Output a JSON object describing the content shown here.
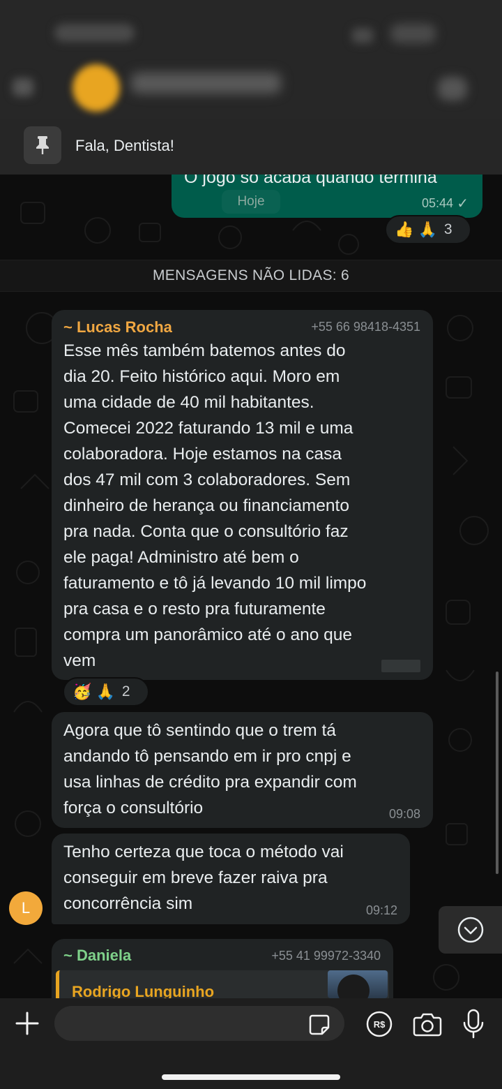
{
  "pinned": {
    "text": "Fala, Dentista!"
  },
  "outgoing": {
    "text": "O jogo só acaba quando termina",
    "date_pill": "Hoje",
    "time": "05:44",
    "check": "✓",
    "reaction": {
      "emojis": "👍 🙏",
      "count": "3"
    }
  },
  "unread": {
    "label": "MENSAGENS NÃO LIDAS: 6"
  },
  "messages": [
    {
      "sender": "~ Lucas Rocha",
      "phone": "+55 66 98418-4351",
      "lines": [
        "Esse mês também batemos antes do",
        "dia 20. Feito  histórico aqui. Moro em",
        "uma cidade de 40 mil habitantes.",
        "Comecei 2022 faturando 13 mil e uma",
        "colaboradora. Hoje estamos na casa",
        "dos 47 mil com 3 colaboradores. Sem",
        "dinheiro de herança ou financiamento",
        "pra nada. Conta que o consultório faz",
        "ele paga! Administro até bem o",
        "faturamento e tô já levando 10 mil limpo",
        "pra casa e o resto pra futuramente",
        "compra um panorâmico até o ano que",
        "vem"
      ],
      "reaction": {
        "emojis": "🥳 🙏",
        "count": "2"
      }
    },
    {
      "lines": [
        "Agora que tô sentindo que o trem tá",
        "andando tô pensando em ir pro cnpj e",
        "usa linhas de crédito pra expandir com",
        "força o consultório"
      ],
      "time": "09:08"
    },
    {
      "lines": [
        "Tenho certeza que toca o método vai",
        "conseguir em breve fazer raiva pra",
        "concorrência sim"
      ],
      "time": "09:12",
      "avatar_letter": "L"
    },
    {
      "sender": "~ Daniela",
      "phone": "+55 41 99972-3340",
      "quote_name": "Rodrigo Lunguinho"
    }
  ],
  "input": {
    "value": "",
    "placeholder": ""
  },
  "colors": {
    "outgoing_bubble": "#005c4b",
    "incoming_bubble": "#202324",
    "sender_lucas": "#f0a742",
    "sender_daniela": "#7fd18a",
    "quote_accent": "#e8a521"
  },
  "icons": {
    "pin": "pin-icon",
    "plus": "plus-icon",
    "sticker": "sticker-icon",
    "payment": "payment-icon",
    "camera": "camera-icon",
    "mic": "mic-icon",
    "scroll_down": "chevron-down-icon"
  }
}
